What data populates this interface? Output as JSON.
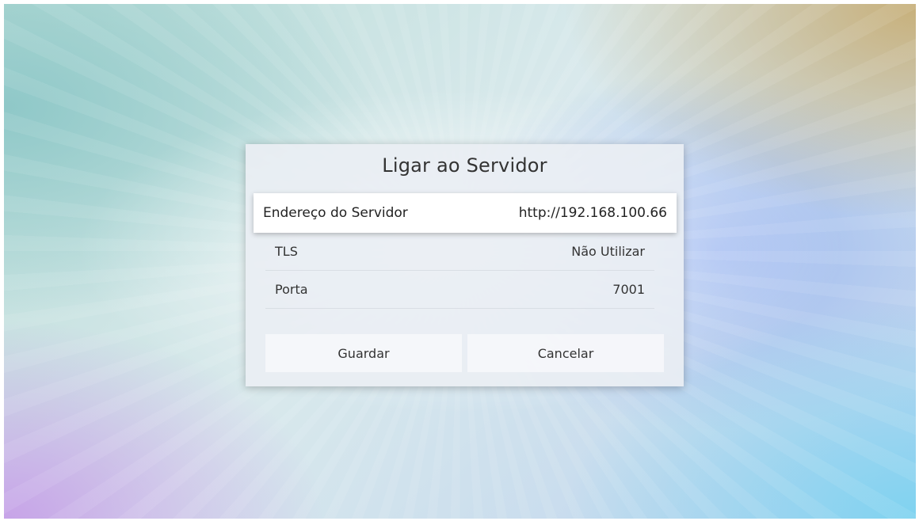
{
  "dialog": {
    "title": "Ligar ao Servidor",
    "rows": [
      {
        "label": "Endereço do Servidor",
        "value": "http://192.168.100.66",
        "focused": true
      },
      {
        "label": "TLS",
        "value": "Não Utilizar"
      },
      {
        "label": "Porta",
        "value": "7001"
      }
    ],
    "buttons": {
      "save_label": "Guardar",
      "cancel_label": "Cancelar"
    }
  }
}
